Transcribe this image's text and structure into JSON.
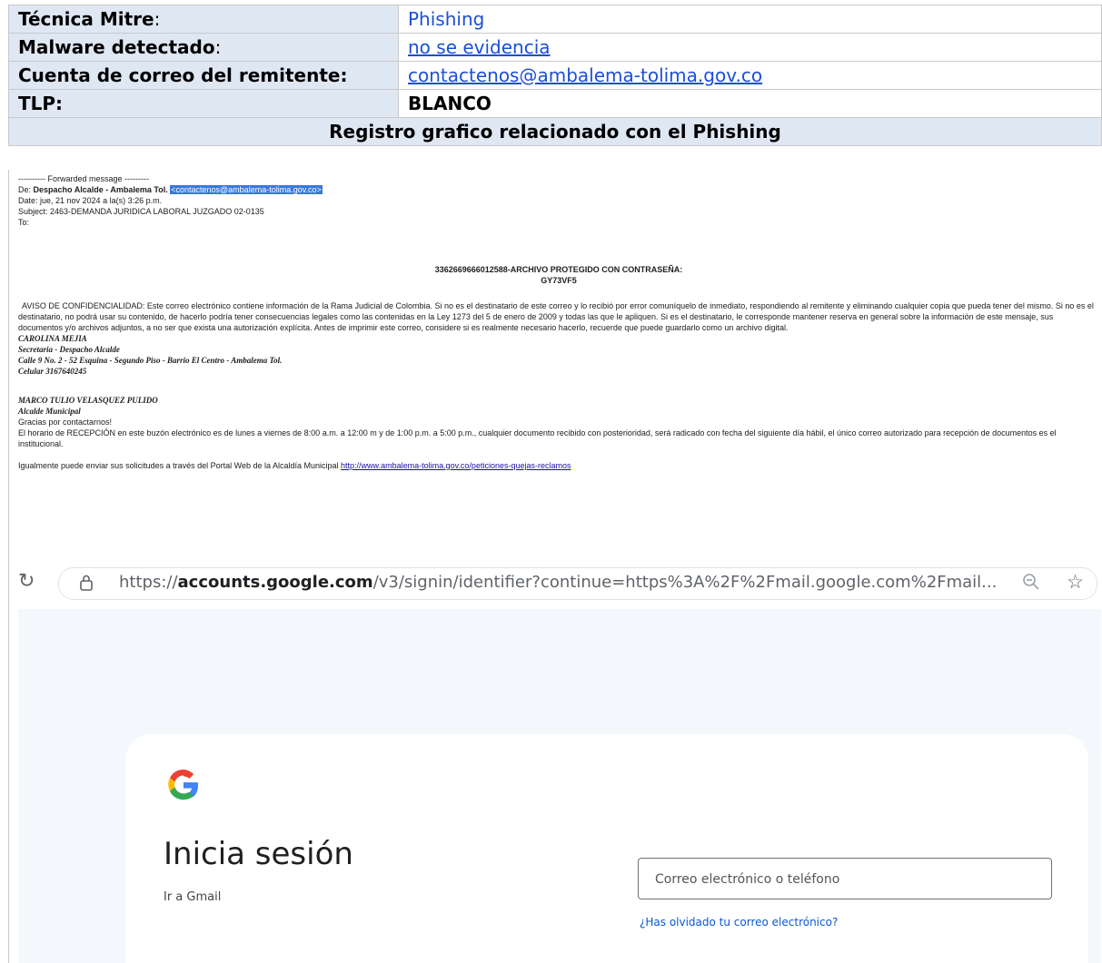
{
  "table": {
    "rows": [
      {
        "key": "Técnica Mitre",
        "sep": ":",
        "value": "Phishing"
      },
      {
        "key": "Malware detectado",
        "sep": ":",
        "value": "no se evidencia"
      },
      {
        "key": "Cuenta de correo del remitente:",
        "sep": "",
        "value": "contactenos@ambalema-tolima.gov.co"
      },
      {
        "key": "TLP:",
        "sep": "",
        "value": "BLANCO"
      }
    ],
    "section_title": "Registro grafico relacionado con el Phishing"
  },
  "email": {
    "forwarded": "---------- Forwarded message ---------",
    "from_label": "De: ",
    "from_name": "Despacho Alcalde - Ambalema Tol.",
    "from_address": "<contactenos@ambalema-tolima.gov.co>",
    "date": "Date: jue, 21 nov 2024 a la(s) 3:26 p.m.",
    "subject": "Subject: 2463-DEMANDA JURIDICA LABORAL JUZGADO 02-0135",
    "to": "To:",
    "archive_line1": "3362669666012588-ARCHIVO PROTEGIDO CON CONTRASEÑA:",
    "archive_line2": "GY73VF5",
    "confidentiality": "AVISO DE CONFIDENCIALIDAD: Este correo electrónico contiene información de la Rama Judicial de Colombia. Si no es el destinatario de este correo y lo recibió por error comuníquelo de inmediato, respondiendo al remitente y eliminando cualquier copia que pueda tener del mismo. Si no es el destinatario, no podrá usar su contenido, de hacerlo podría tener consecuencias legales como las contenidas en la Ley 1273 del 5 de enero de 2009 y todas las que le apliquen. Si es el destinatario, le corresponde mantener reserva en general sobre la información de este mensaje, sus documentos y/o archivos adjuntos, a no ser que exista una autorización explícita. Antes de imprimir este correo, considere si es realmente necesario hacerlo, recuerde que puede guardarlo como un archivo digital.",
    "sig1_name": "CAROLINA MEJIA",
    "sig1_role": "Secretaria - Despacho Alcalde",
    "sig1_address": "Calle 9 No. 2 - 52 Esquina - Segundo Piso - Barrio El Centro - Ambalema Tol.",
    "sig1_phone": "Celular 3167640245",
    "sig2_name": "MARCO TULIO VELASQUEZ PULIDO",
    "sig2_role": "Alcalde Municipal",
    "thanks": "Gracias por contactarnos!",
    "schedule": "El horario de RECEPCIÓN en este buzón electrónico es de lunes a viernes de 8:00 a.m. a 12:00 m y de 1:00 p.m. a 5:00 p.m., cualquier documento recibido con posterioridad, será radicado con fecha del siguiente día hábil, el único correo autorizado para recepción de documentos es el institucional.",
    "portal_text": "Igualmente puede enviar sus solicitudes a través del Portal Web de la Alcaldía Municipal ",
    "portal_link": "http://www.ambalema-tolima.gov.co/peticiones-quejas-reclamos"
  },
  "browser": {
    "url_scheme": "https://",
    "url_domain": "accounts.google.com",
    "url_path": "/v3/signin/identifier?continue=https%3A%2F%2Fmail.google.com%2Fmail...",
    "icons": [
      "reload-icon",
      "lock-icon",
      "zoom-icon",
      "star-icon"
    ]
  },
  "signin": {
    "logo": "G",
    "title": "Inicia sesión",
    "subtitle": "Ir a Gmail",
    "input_placeholder": "Correo electrónico o teléfono",
    "forgot_link": "¿Has olvidado tu correo electrónico?"
  },
  "colors": {
    "header_bg": "#dfe7f3",
    "link_blue": "#1c4fd8",
    "google_blue": "#4285f4"
  }
}
